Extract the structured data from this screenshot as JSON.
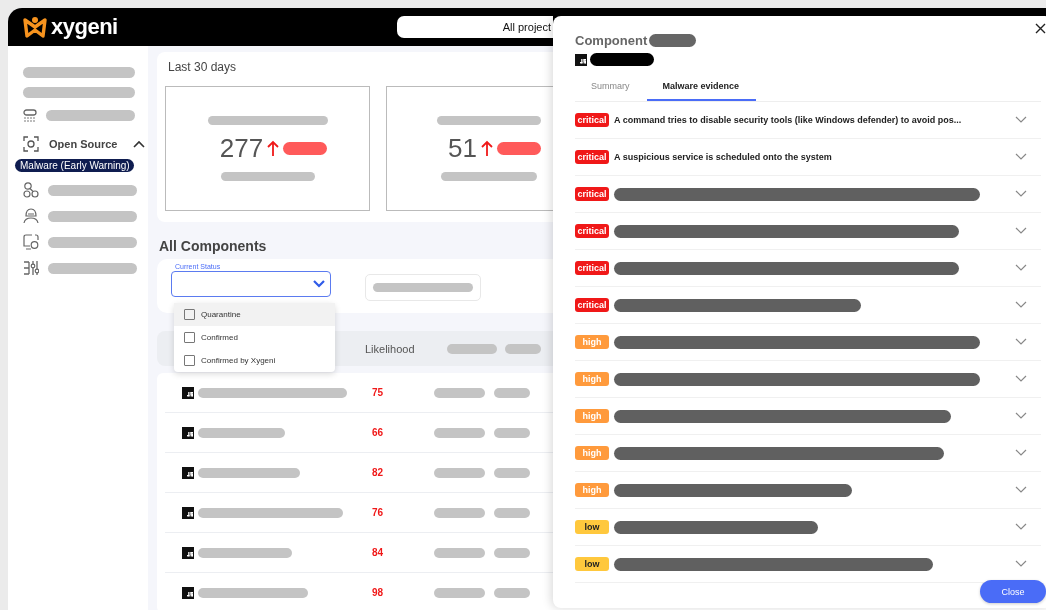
{
  "header": {
    "logo": "xygeni",
    "project_selector": "All project"
  },
  "sidebar": {
    "section": {
      "label": "Open Source",
      "expanded": true
    },
    "active_item": "Malware (Early Warning)"
  },
  "summary": {
    "title": "Last 30 days",
    "stats": [
      {
        "value": "277"
      },
      {
        "value": "51"
      }
    ]
  },
  "components": {
    "title": "All Components",
    "status_filter": {
      "label": "Current Status",
      "expanded": true,
      "options": [
        {
          "label": "Quarantine",
          "checked": false,
          "highlighted": true
        },
        {
          "label": "Confirmed",
          "checked": false,
          "highlighted": false
        },
        {
          "label": "Confirmed by Xygeni",
          "checked": false,
          "highlighted": false
        }
      ]
    },
    "columns": [
      {
        "label": "Likelihood"
      }
    ],
    "rows": [
      {
        "likelihood": "75"
      },
      {
        "likelihood": "66"
      },
      {
        "likelihood": "82"
      },
      {
        "likelihood": "76"
      },
      {
        "likelihood": "84"
      },
      {
        "likelihood": "98"
      }
    ]
  },
  "drawer": {
    "title": "Component",
    "tabs": [
      {
        "label": "Summary",
        "selected": false
      },
      {
        "label": "Malware evidence",
        "selected": true
      }
    ],
    "evidence": [
      {
        "severity": "critical",
        "title": "A command tries to disable security tools (like Windows defender) to avoid pos..."
      },
      {
        "severity": "critical",
        "title": "A suspicious service is scheduled onto the system"
      },
      {
        "severity": "critical"
      },
      {
        "severity": "critical"
      },
      {
        "severity": "critical"
      },
      {
        "severity": "critical"
      },
      {
        "severity": "high"
      },
      {
        "severity": "high"
      },
      {
        "severity": "high"
      },
      {
        "severity": "high"
      },
      {
        "severity": "high"
      },
      {
        "severity": "low"
      },
      {
        "severity": "low"
      }
    ],
    "close_button": "Close"
  }
}
